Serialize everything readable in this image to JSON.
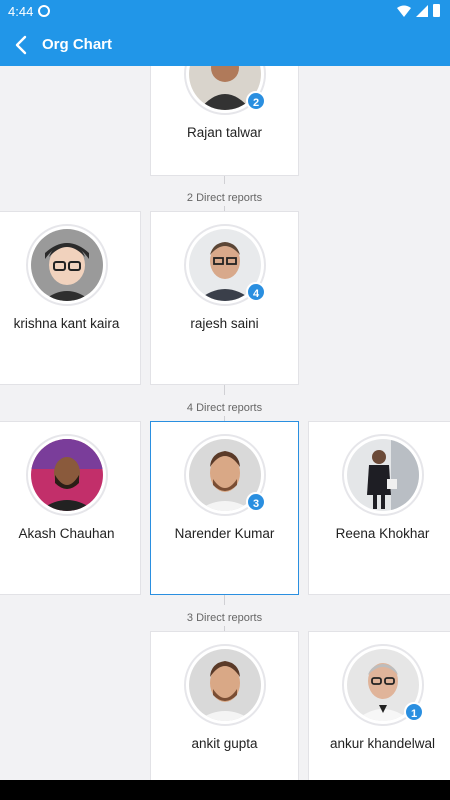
{
  "status": {
    "time": "4:44"
  },
  "header": {
    "title": "Org Chart"
  },
  "levels": [
    {
      "cards": [
        {
          "name": "Rajan talwar",
          "badge": "2"
        }
      ],
      "reports_label": "2 Direct reports"
    },
    {
      "cards": [
        {
          "name": "krishna kant kaira"
        },
        {
          "name": "rajesh saini",
          "badge": "4"
        }
      ],
      "reports_label": "4 Direct reports"
    },
    {
      "cards": [
        {
          "name": "Akash Chauhan"
        },
        {
          "name": "Narender Kumar",
          "badge": "3",
          "selected": true
        },
        {
          "name": "Reena Khokhar"
        }
      ],
      "reports_label": "3 Direct reports"
    },
    {
      "cards": [
        {
          "name": "ankit gupta"
        },
        {
          "name": "ankur khandelwal",
          "badge": "1"
        }
      ]
    }
  ],
  "colors": {
    "accent": "#2196e8",
    "badge": "#2a8fe0"
  }
}
